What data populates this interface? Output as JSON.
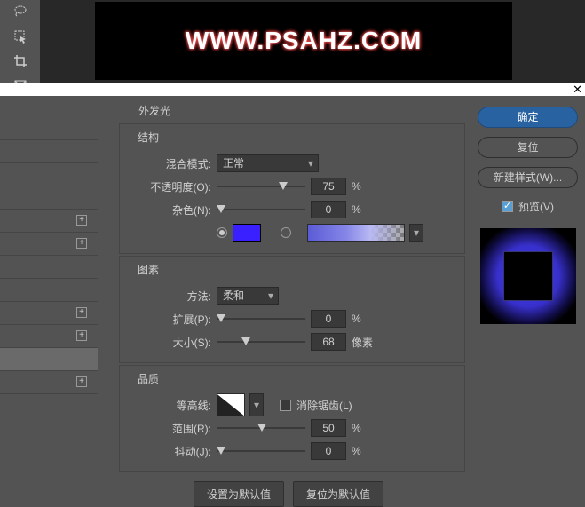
{
  "watermark": "WWW.PSAHZ.COM",
  "dialog": {
    "title": "外发光",
    "sections": {
      "structure": "结构",
      "elements": "图素",
      "quality": "品质"
    }
  },
  "structure": {
    "blend_mode_label": "混合模式:",
    "blend_mode_value": "正常",
    "opacity_label": "不透明度(O):",
    "opacity_value": "75",
    "opacity_unit": "%",
    "noise_label": "杂色(N):",
    "noise_value": "0",
    "noise_unit": "%"
  },
  "elements": {
    "technique_label": "方法:",
    "technique_value": "柔和",
    "spread_label": "扩展(P):",
    "spread_value": "0",
    "spread_unit": "%",
    "size_label": "大小(S):",
    "size_value": "68",
    "size_unit": "像素"
  },
  "quality": {
    "contour_label": "等高线:",
    "antialias_label": "消除锯齿(L)",
    "range_label": "范围(R):",
    "range_value": "50",
    "range_unit": "%",
    "jitter_label": "抖动(J):",
    "jitter_value": "0",
    "jitter_unit": "%"
  },
  "buttons": {
    "default": "设置为默认值",
    "reset_default": "复位为默认值",
    "ok": "确定",
    "reset": "复位",
    "new_style": "新建样式(W)...",
    "preview": "预览(V)"
  },
  "colors": {
    "solid": "#3a1fff"
  }
}
